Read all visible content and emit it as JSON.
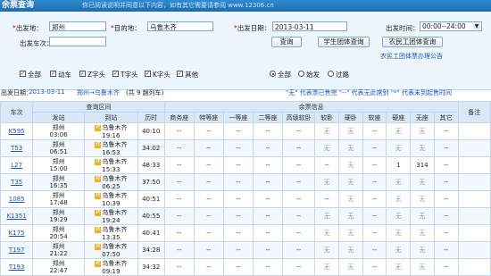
{
  "header": {
    "title": "余票查询",
    "notice": "你已阅读说明并同意以下内容，如有其它需要请参阅 www.12306.cn"
  },
  "form": {
    "from_label": "出发地：",
    "from_value": "郑州",
    "to_label": "目的地：",
    "to_value": "乌鲁木齐",
    "date_label": "出发日期：",
    "date_value": "2013-03-11",
    "time_label": "出发时间：",
    "time_value": "00:00--24:00",
    "station_label": "出发车次：",
    "station_value": "",
    "query_button": "查询",
    "student_button": "学生团体查询",
    "migrant_button": "农民工团体查询",
    "migrant_link": "农民工团体票办理公告",
    "train_types": [
      {
        "label": "全部",
        "checked": true
      },
      {
        "label": "动车",
        "checked": true
      },
      {
        "label": "Z字头",
        "checked": true
      },
      {
        "label": "T字头",
        "checked": true
      },
      {
        "label": "K字头",
        "checked": true
      },
      {
        "label": "其他",
        "checked": true
      }
    ],
    "pass_types": [
      {
        "label": "全部",
        "selected": true
      },
      {
        "label": "始发",
        "selected": false
      },
      {
        "label": "过路",
        "selected": false
      }
    ]
  },
  "info": {
    "date_label": "出发日期：",
    "date_value": "2013-03-11",
    "route": "郑州→乌鲁木齐",
    "count_text": "(共 9 趟列车)",
    "legend": "\"无\" 代表票已售完    \"--\" 代表无此席别    \"*\" 代表未到起售时间"
  },
  "table": {
    "group_query": "查询区间",
    "group_remain": "余票信息",
    "col_train": "车次",
    "col_depart": "发站",
    "col_arrive": "到站",
    "col_duration": "历时",
    "col_remark": "备注",
    "seat_columns": [
      "商务座",
      "特等座",
      "一等座",
      "二等座",
      "高级软卧",
      "软卧",
      "硬卧",
      "软座",
      "硬座",
      "无座",
      "其它"
    ],
    "rows": [
      {
        "train": "K595",
        "depart": "郑州",
        "depart_time": "03:06",
        "arrive": "乌鲁木齐",
        "arrive_time": "19:16",
        "duration": "40:10",
        "seats": [
          "--",
          "--",
          "--",
          "--",
          "--",
          "无",
          "无",
          "--",
          "无",
          "无",
          "--"
        ],
        "remark": ""
      },
      {
        "train": "T53",
        "depart": "郑州",
        "depart_time": "06:51",
        "arrive": "乌鲁木齐",
        "arrive_time": "16:53",
        "duration": "34:02",
        "seats": [
          "--",
          "--",
          "--",
          "--",
          "--",
          "无",
          "无",
          "--",
          "无",
          "无",
          "--"
        ],
        "remark": ""
      },
      {
        "train": "L27",
        "depart": "郑州",
        "depart_time": "15:00",
        "arrive": "乌鲁木齐",
        "arrive_time": "15:33",
        "duration": "48:33",
        "seats": [
          "--",
          "--",
          "--",
          "--",
          "--",
          "--",
          "无",
          "--",
          "1",
          "314",
          "--"
        ],
        "remark": ""
      },
      {
        "train": "T35",
        "depart": "郑州",
        "depart_time": "16:35",
        "arrive": "乌鲁木齐",
        "arrive_time": "06:25",
        "duration": "37:50",
        "seats": [
          "--",
          "--",
          "--",
          "--",
          "--",
          "无",
          "无",
          "--",
          "无",
          "无",
          "--"
        ],
        "remark": ""
      },
      {
        "train": "1085",
        "depart": "郑州",
        "depart_time": "17:48",
        "arrive": "乌鲁木齐",
        "arrive_time": "10:39",
        "duration": "40:51",
        "seats": [
          "--",
          "--",
          "--",
          "--",
          "--",
          "--",
          "无",
          "--",
          "无",
          "无",
          "--"
        ],
        "remark": ""
      },
      {
        "train": "K1351",
        "depart": "郑州",
        "depart_time": "19:29",
        "arrive": "乌鲁木齐",
        "arrive_time": "19:24",
        "duration": "40:55",
        "seats": [
          "--",
          "--",
          "--",
          "--",
          "--",
          "无",
          "无",
          "--",
          "无",
          "无",
          "--"
        ],
        "remark": ""
      },
      {
        "train": "K175",
        "depart": "郑州",
        "depart_time": "20:54",
        "arrive": "乌鲁木齐",
        "arrive_time": "13:35",
        "duration": "40:41",
        "seats": [
          "--",
          "--",
          "--",
          "--",
          "--",
          "无",
          "无",
          "--",
          "无",
          "无",
          "--"
        ],
        "remark": ""
      },
      {
        "train": "T197",
        "depart": "郑州",
        "depart_time": "21:22",
        "arrive": "乌鲁木齐",
        "arrive_time": "07:50",
        "duration": "34:28",
        "seats": [
          "--",
          "--",
          "--",
          "--",
          "--",
          "无",
          "无",
          "--",
          "无",
          "无",
          "--"
        ],
        "remark": ""
      },
      {
        "train": "T193",
        "depart": "郑州",
        "depart_time": "22:47",
        "arrive": "乌鲁木齐",
        "arrive_time": "09:19",
        "duration": "34:32",
        "seats": [
          "--",
          "--",
          "--",
          "--",
          "--",
          "无",
          "无",
          "--",
          "无",
          "无",
          "--"
        ],
        "remark": ""
      }
    ]
  },
  "colors": {
    "header_blue": "#1d6bb0",
    "link_blue": "#1a55b0",
    "table_header": "#d9e8f7",
    "badge_gold": "#e0b320"
  },
  "icons": {
    "depart_badge": "start-station-badge",
    "arrive_badge": "terminal-station-badge",
    "dropdown": "chevron-down-icon"
  }
}
